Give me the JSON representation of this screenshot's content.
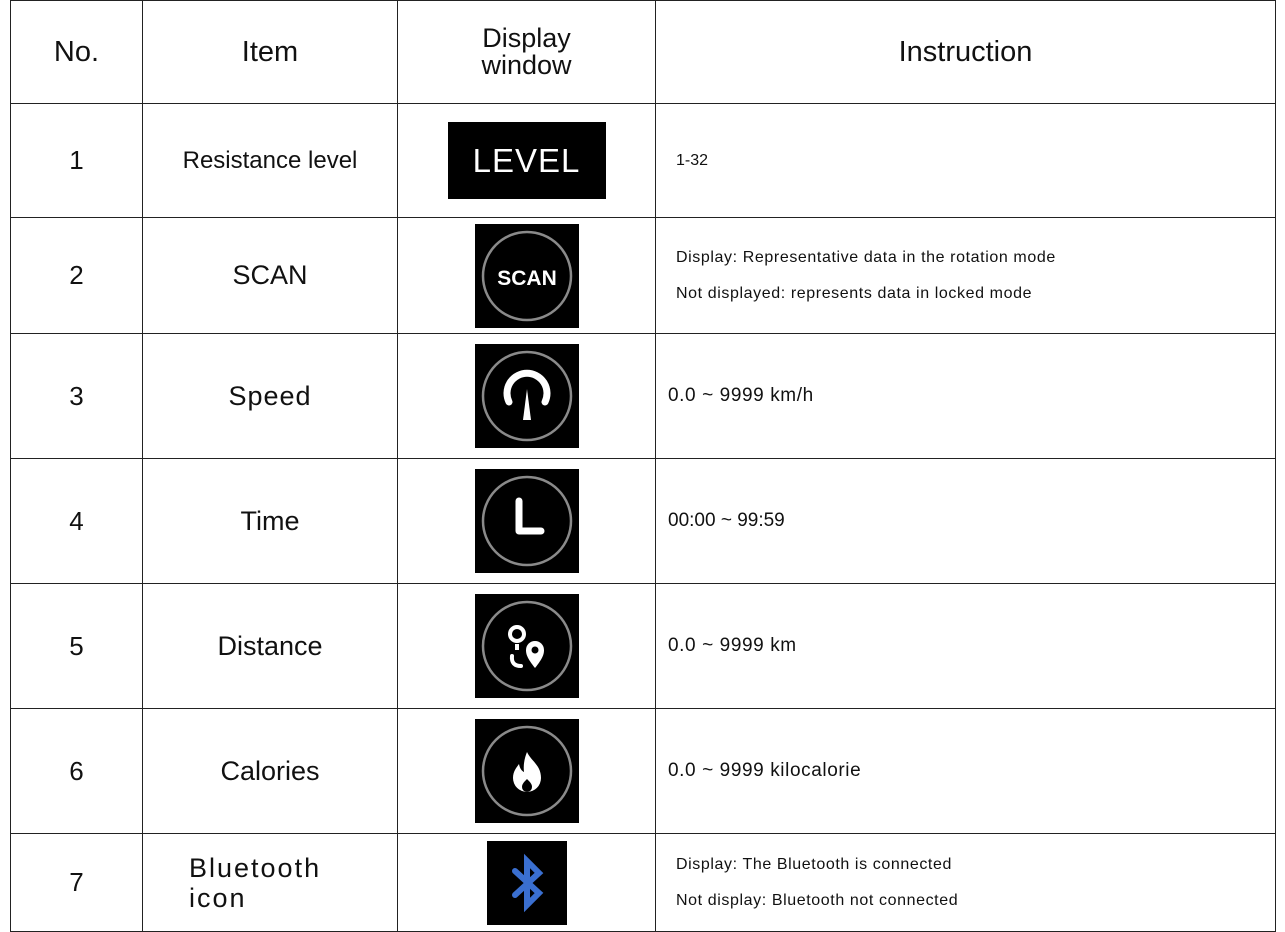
{
  "headers": {
    "no": "No.",
    "item": "Item",
    "display_line1": "Display",
    "display_line2": "window",
    "instruction": "Instruction"
  },
  "rows": [
    {
      "no": "1",
      "item": "Resistance level",
      "icon": "level-display-icon",
      "icon_text": "LEVEL",
      "instruction": [
        "1-32"
      ]
    },
    {
      "no": "2",
      "item": "SCAN",
      "icon": "scan-icon",
      "icon_text": "SCAN",
      "instruction": [
        "Display: Representative data in the rotation mode",
        "Not displayed: represents data in locked mode"
      ]
    },
    {
      "no": "3",
      "item": "Speed",
      "icon": "speedometer-icon",
      "instruction": [
        "0.0 ~ 9999 km/h"
      ]
    },
    {
      "no": "4",
      "item": "Time",
      "icon": "clock-icon",
      "instruction": [
        "00:00  ~ 99:59"
      ]
    },
    {
      "no": "5",
      "item": "Distance",
      "icon": "route-pin-icon",
      "instruction": [
        "0.0 ~ 9999 km"
      ]
    },
    {
      "no": "6",
      "item": "Calories",
      "icon": "flame-icon",
      "instruction": [
        "0.0 ~ 9999 kilocalorie"
      ]
    },
    {
      "no": "7",
      "item_line1": "Bluetooth",
      "item_line2": "icon",
      "icon": "bluetooth-icon",
      "instruction": [
        "Display: The Bluetooth is connected",
        "Not display: Bluetooth not connected"
      ]
    }
  ],
  "colors": {
    "icon_bg": "#000000",
    "icon_fg": "#ffffff",
    "ring": "#8a8a8a",
    "bluetooth": "#3a6fd0"
  }
}
